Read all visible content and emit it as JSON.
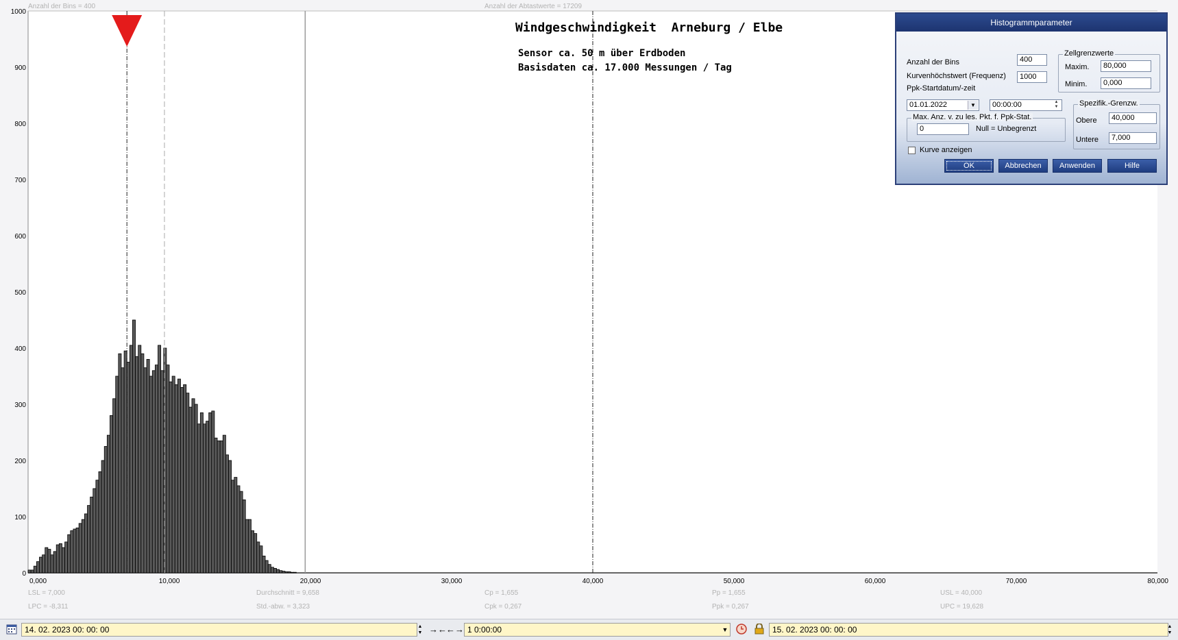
{
  "header": {
    "bins_info": "Anzahl der Bins =   400",
    "samples_info": "Anzahl der Abtastwerte = 17209"
  },
  "chart_data": {
    "type": "bar",
    "title": "Windgeschwindigkeit  Arneburg / Elbe",
    "subtitle_lines": [
      "Sensor ca. 50 m über Erdboden",
      "Basisdaten ca. 17.000 Messungen / Tag"
    ],
    "xlim": [
      0,
      80
    ],
    "ylim": [
      0,
      1000
    ],
    "x_tick_labels": [
      "0,000",
      "10,000",
      "20,000",
      "30,000",
      "40,000",
      "50,000",
      "60,000",
      "70,000",
      "80,000"
    ],
    "y_tick_labels": [
      "0",
      "100",
      "200",
      "300",
      "400",
      "500",
      "600",
      "700",
      "800",
      "900",
      "1000"
    ],
    "bin_width": 0.2,
    "bin_start": 0.0,
    "values": [
      5,
      5,
      12,
      20,
      28,
      32,
      45,
      42,
      32,
      38,
      50,
      52,
      45,
      55,
      68,
      75,
      78,
      80,
      88,
      95,
      105,
      120,
      135,
      150,
      165,
      180,
      200,
      225,
      245,
      280,
      310,
      350,
      390,
      365,
      395,
      375,
      405,
      450,
      385,
      405,
      390,
      365,
      380,
      350,
      360,
      370,
      405,
      360,
      400,
      370,
      340,
      350,
      335,
      345,
      330,
      335,
      320,
      295,
      310,
      300,
      265,
      285,
      265,
      270,
      285,
      288,
      240,
      235,
      235,
      245,
      210,
      200,
      165,
      170,
      155,
      145,
      130,
      95,
      95,
      75,
      70,
      55,
      48,
      30,
      22,
      15,
      10,
      8,
      6,
      4,
      3,
      2,
      2,
      1,
      1
    ],
    "bar_color": "#5a5a5a",
    "lines": {
      "lsl": 7.0,
      "mean": 9.658,
      "limit_20": 19.628,
      "usl": 40.0
    },
    "marker_color": "#e41b1b"
  },
  "stats": [
    [
      "LSL = 7,000",
      "LPC = -8,311"
    ],
    [
      "Durchschnitt  = 9,658",
      "Std.-abw. = 3,323"
    ],
    [
      "Cp = 1,655",
      "Cpk = 0,267"
    ],
    [
      "Pp = 1,655",
      "Ppk = 0,267"
    ],
    [
      "USL = 40,000",
      "UPC = 19,628"
    ]
  ],
  "dialog": {
    "title": "Histogrammparameter",
    "bins_label": "Anzahl der Bins",
    "bins_value": "400",
    "curve_max_label": "Kurvenhöchstwert (Frequenz)",
    "curve_max_value": "1000",
    "ppk_start_label": "Ppk-Startdatum/-zeit",
    "ppk_date": "01.01.2022",
    "ppk_time": "00:00:00",
    "cell_limits_title": "Zellgrenzwerte",
    "max_label": "Maxim.",
    "max_value": "80,000",
    "min_label": "Minim.",
    "min_value": "0,000",
    "max_points_title": "Max. Anz. v. zu les. Pkt. f. Ppk-Stat.",
    "max_points_value": "0",
    "null_hint": "Null = Unbegrenzt",
    "spec_title": "Spezifik.-Grenzw.",
    "upper_label": "Obere",
    "upper_value": "40,000",
    "lower_label": "Untere",
    "lower_value": "7,000",
    "show_curve_label": "Kurve anzeigen",
    "show_curve_checked": false,
    "buttons": {
      "ok": "OK",
      "cancel": "Abbrechen",
      "apply": "Anwenden",
      "help": "Hilfe"
    }
  },
  "bottombar": {
    "start": "14. 02. 2023    00: 00: 00",
    "interval": "1 0:00:00",
    "end": "15. 02. 2023    00: 00: 00"
  }
}
